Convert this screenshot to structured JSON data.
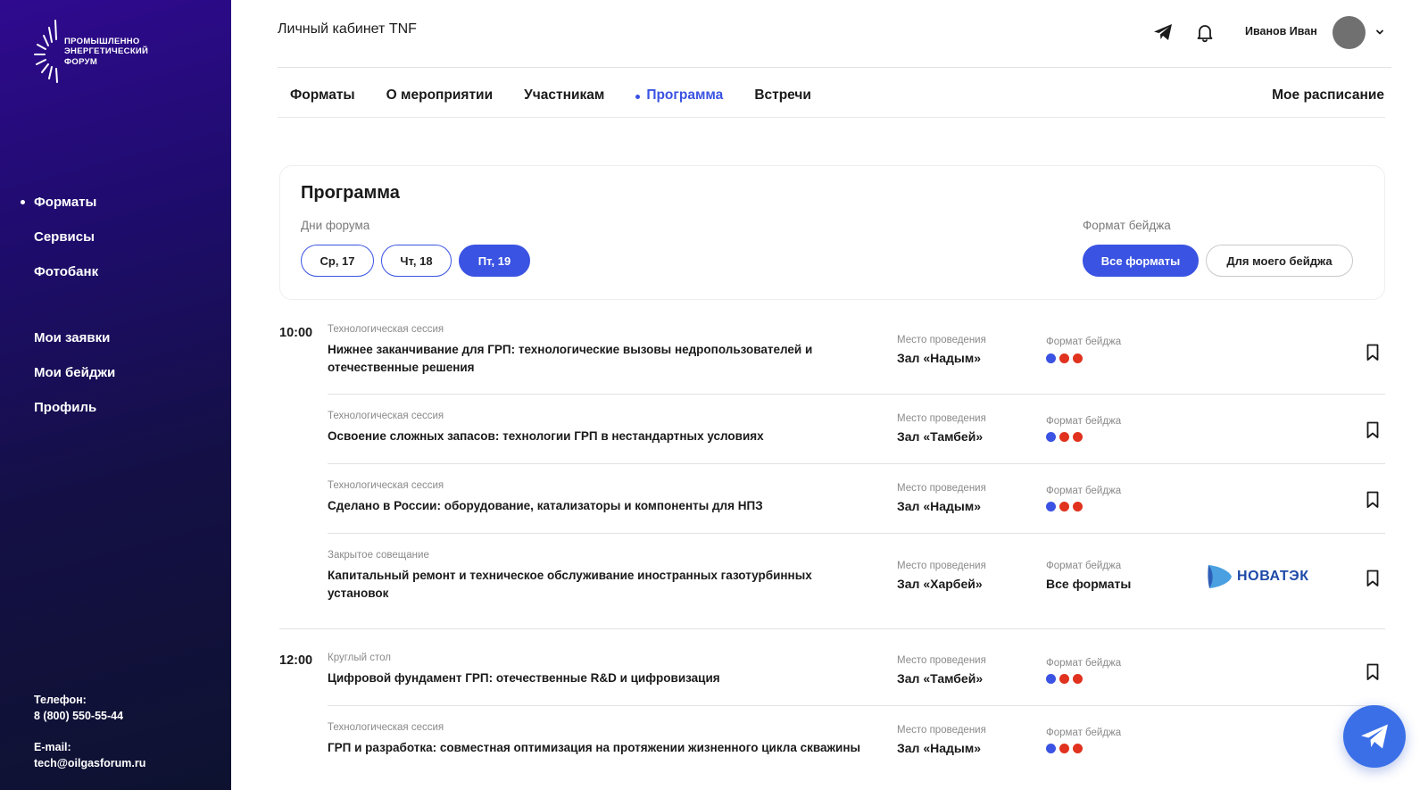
{
  "sidebar": {
    "logo_lines": [
      "ПРОМЫШЛЕННО",
      "ЭНЕРГЕТИЧЕСКИЙ",
      "ФОРУМ"
    ],
    "nav_main": [
      {
        "label": "Форматы",
        "active": true
      },
      {
        "label": "Сервисы",
        "active": false
      },
      {
        "label": "Фотобанк",
        "active": false
      }
    ],
    "nav_secondary": [
      {
        "label": "Мои заявки"
      },
      {
        "label": "Мои бейджи"
      },
      {
        "label": "Профиль"
      }
    ],
    "phone_label": "Телефон:",
    "phone_value": "8 (800) 550-55-44",
    "email_label": "E-mail:",
    "email_value": "tech@oilgasforum.ru"
  },
  "header": {
    "title": "Личный кабинет TNF",
    "user_name": "Иванов Иван",
    "icons": [
      "telegram-icon",
      "bell-icon",
      "chevron-down-icon"
    ]
  },
  "tabs": [
    {
      "label": "Форматы",
      "active": false
    },
    {
      "label": "О мероприятии",
      "active": false
    },
    {
      "label": "Участникам",
      "active": false
    },
    {
      "label": "Программа",
      "active": true
    },
    {
      "label": "Встречи",
      "active": false
    }
  ],
  "my_schedule_label": "Мое расписание",
  "filter": {
    "title": "Программа",
    "days_label": "Дни форума",
    "days": [
      {
        "label": "Ср, 17",
        "selected": false
      },
      {
        "label": "Чт, 18",
        "selected": false
      },
      {
        "label": "Пт, 19",
        "selected": true
      }
    ],
    "badge_label": "Формат бейджа",
    "badge_options": [
      {
        "label": "Все форматы",
        "selected": true
      },
      {
        "label": "Для моего бейджа",
        "selected": false
      }
    ]
  },
  "colors": {
    "accent": "#3a53e2",
    "dot_blue": "#3a53e2",
    "dot_red": "#e0321e",
    "sidebar_top": "#2f0a8f",
    "sidebar_bottom": "#0e1230"
  },
  "schedule": {
    "venue_label": "Место проведения",
    "badge_label": "Формат бейджа",
    "times": [
      "10:00",
      "12:00"
    ],
    "sessions": [
      {
        "type": "Технологическая сессия",
        "title": "Нижнее заканчивание для ГРП: технологические вызовы недропользователей и отечественные решения",
        "venue": "Зал «Надым»",
        "badge": "dots"
      },
      {
        "type": "Технологическая сессия",
        "title": "Освоение сложных запасов: технологии ГРП в нестандартных условиях",
        "venue": "Зал «Тамбей»",
        "badge": "dots"
      },
      {
        "type": "Технологическая сессия",
        "title": "Сделано в России: оборудование, катализаторы и компоненты для НПЗ",
        "venue": "Зал «Надым»",
        "badge": "dots"
      },
      {
        "type": "Закрытое совещание",
        "title": "Капитальный ремонт и техническое обслуживание иностранных газотурбинных установок",
        "venue": "Зал «Харбей»",
        "badge_text": "Все форматы",
        "sponsor": "НОВАТЭК"
      },
      {
        "type": "Круглый стол",
        "title": "Цифровой фундамент ГРП: отечественные R&D и цифровизация",
        "venue": "Зал «Тамбей»",
        "badge": "dots"
      },
      {
        "type": "Технологическая сессия",
        "title": "ГРП и разработка: совместная оптимизация на протяжении жизненного цикла скважины",
        "venue": "Зал «Надым»",
        "badge": "dots"
      }
    ]
  }
}
